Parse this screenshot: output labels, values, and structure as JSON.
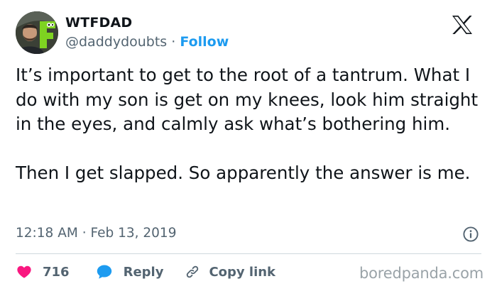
{
  "author": {
    "display_name": "WTFDAD",
    "handle": "@daddydoubts",
    "separator": "·",
    "follow_label": "Follow"
  },
  "tweet": {
    "paragraphs": [
      "It’s important to get to the root of a tantrum. What I do with my son is get on my knees, look him straight in the eyes, and calmly ask what’s bothering him.",
      "Then I get slapped. So apparently the answer is me."
    ],
    "timestamp": "12:18 AM · Feb 13, 2019"
  },
  "actions": {
    "like_count": "716",
    "reply_label": "Reply",
    "copy_label": "Copy link"
  },
  "watermark": "boredpanda.com",
  "icons": {
    "brand": "x-logo-icon",
    "info": "info-icon",
    "like": "heart-icon",
    "reply": "speech-bubble-icon",
    "copy": "link-icon"
  },
  "colors": {
    "text": "#0f1419",
    "secondary": "#536471",
    "accent": "#1d9bf0",
    "like": "#f91880",
    "divider": "#cfd9de",
    "watermark": "#9aa3a8"
  }
}
